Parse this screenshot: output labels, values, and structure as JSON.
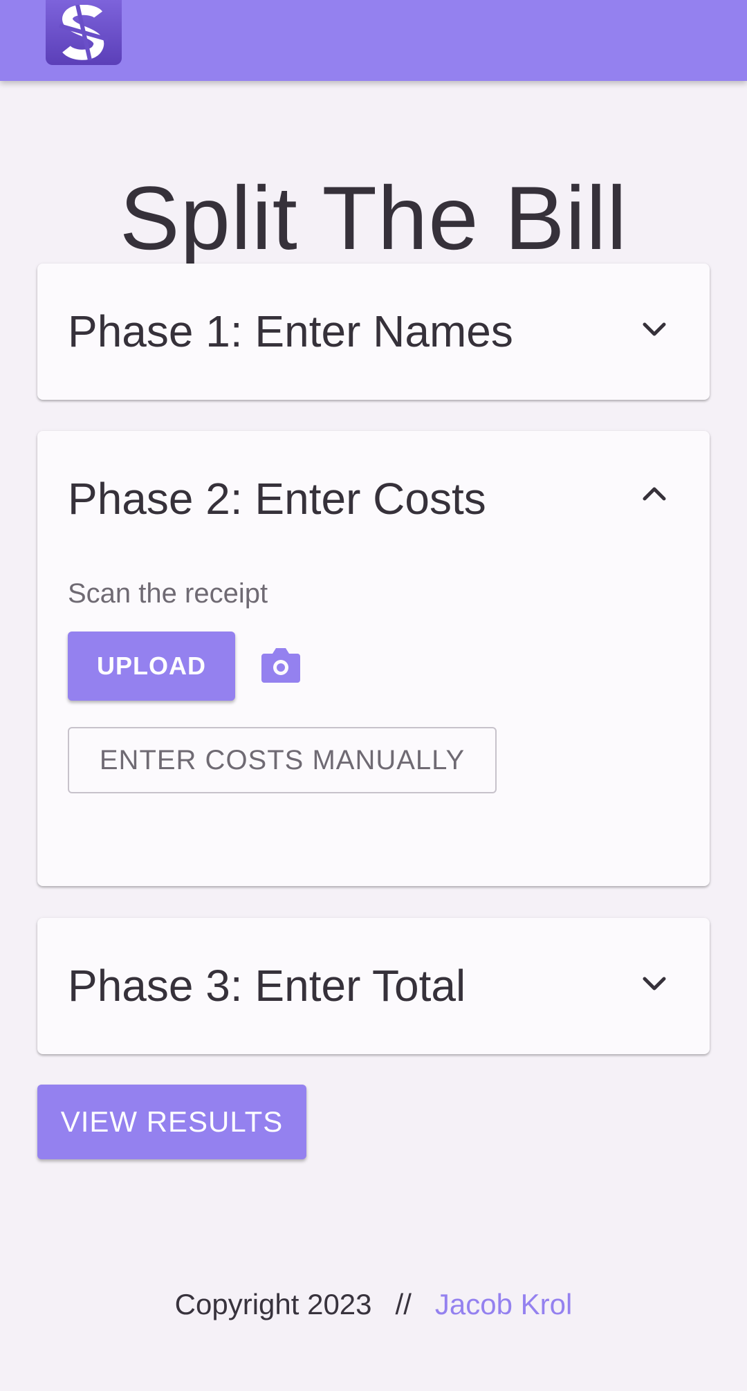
{
  "app": {
    "title": "Split The Bill",
    "brand_color": "#9481ef",
    "logo_icon": "split-s-logo"
  },
  "phases": [
    {
      "title": "Phase 1: Enter Names",
      "expanded": false,
      "toggle_icon": "chevron-down-icon"
    },
    {
      "title": "Phase 2: Enter Costs",
      "expanded": true,
      "toggle_icon": "chevron-up-icon",
      "scan_label": "Scan the receipt",
      "upload_label": "UPLOAD",
      "camera_icon": "camera-icon",
      "manual_label": "ENTER COSTS MANUALLY"
    },
    {
      "title": "Phase 3: Enter Total",
      "expanded": false,
      "toggle_icon": "chevron-down-icon"
    }
  ],
  "actions": {
    "view_results_label": "VIEW RESULTS"
  },
  "footer": {
    "copyright": "Copyright 2023",
    "separator": "//",
    "author": "Jacob Krol"
  }
}
